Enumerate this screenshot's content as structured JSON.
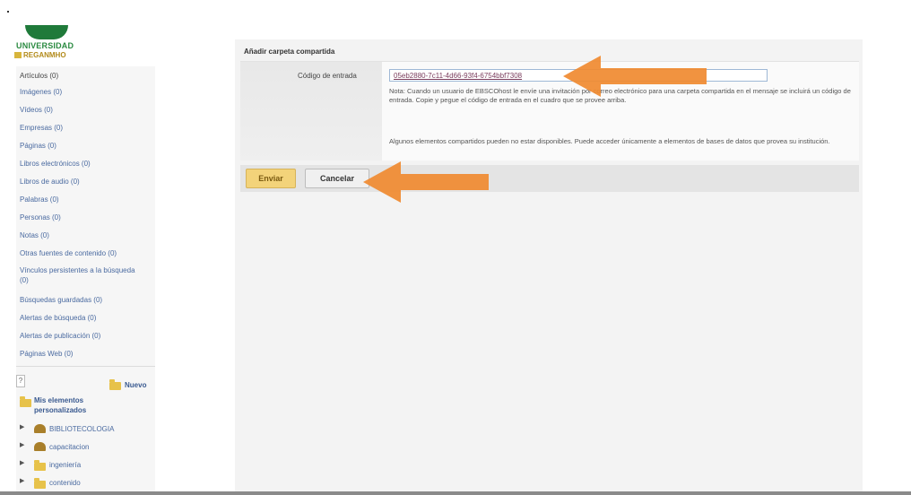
{
  "logo": {
    "name": "UNIVERSIDAD",
    "sub": "REGANMHO"
  },
  "sidebar": {
    "items": [
      {
        "label": "Artículos (0)"
      },
      {
        "label": "Imágenes (0)"
      },
      {
        "label": "Vídeos (0)"
      },
      {
        "label": "Empresas (0)"
      },
      {
        "label": "Páginas (0)"
      },
      {
        "label": "Libros electrónicos (0)"
      },
      {
        "label": "Libros de audio (0)"
      },
      {
        "label": "Palabras (0)"
      },
      {
        "label": "Personas (0)"
      },
      {
        "label": "Notas (0)"
      },
      {
        "label": "Otras fuentes de contenido (0)"
      },
      {
        "label": "Vínculos persistentes a la búsqueda (0)"
      },
      {
        "label": "Búsquedas guardadas (0)"
      },
      {
        "label": "Alertas de búsqueda (0)"
      },
      {
        "label": "Alertas de publicación (0)"
      },
      {
        "label": "Páginas Web (0)"
      }
    ],
    "help": "?",
    "new_folder": "Nuevo",
    "tree_title": "Mis elementos personalizados",
    "tree_items": [
      {
        "label": "BIBLIOTECOLOGIA",
        "icon": "shared-folder-icon"
      },
      {
        "label": "capacitacion",
        "icon": "shared-folder-icon"
      },
      {
        "label": "ingeniería",
        "icon": "folder-icon"
      },
      {
        "label": "contenido",
        "icon": "folder-icon"
      }
    ]
  },
  "panel": {
    "title": "Añadir carpeta compartida",
    "code_label": "Código de entrada",
    "code_value": "05eb2880-7c11-4d66-93f4-6754bbf7308",
    "note": "Nota: Cuando un usuario de EBSCOhost le envíe una invitación por correo electrónico para una carpeta compartida en el mensaje se incluirá un código de entrada. Copie y pegue el código de entrada en el cuadro que se provee arriba.",
    "note2": "Algunos elementos compartidos pueden no estar disponibles. Puede acceder únicamente a elementos de bases de datos que provea su institución.",
    "submit": "Enviar",
    "cancel": "Cancelar"
  },
  "colors": {
    "accent_arrow": "#f08a30",
    "brand_green": "#1f7a3a"
  }
}
